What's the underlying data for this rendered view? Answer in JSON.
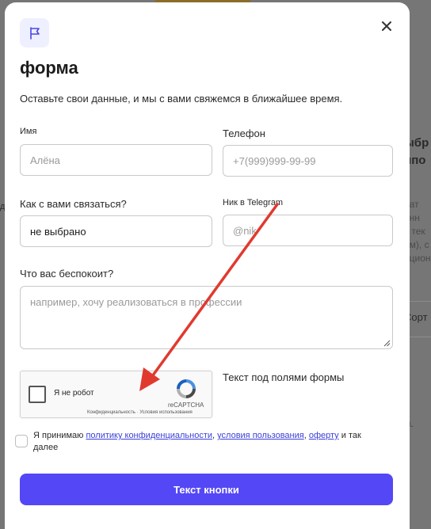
{
  "background": {
    "fragments": [
      "ыбр",
      "ипо",
      "рат",
      "анн",
      "с тек",
      "ом), с",
      "ацион",
      "Сорт",
      "м."
    ],
    "left_mark": "д"
  },
  "modal": {
    "logo_icon": "flag-icon",
    "close_icon": "close-icon",
    "title": "форма",
    "subtitle": "Оставьте свои данные, и мы с вами свяжемся в ближайшее время.",
    "fields": {
      "name": {
        "label": "Имя",
        "placeholder": "Алёна"
      },
      "phone": {
        "label": "Телефон",
        "placeholder": "+7(999)999-99-99"
      },
      "contact_method": {
        "label": "Как с вами связаться?",
        "value": "не выбрано"
      },
      "telegram": {
        "label": "Ник в Telegram",
        "placeholder": "@nik"
      },
      "concern": {
        "label": "Что вас беспокоит?",
        "placeholder": "например, хочу реализоваться в профессии"
      }
    },
    "recaptcha": {
      "label": "Я не робот",
      "brand": "reCAPTCHA",
      "terms": "Конфиденциальность · Условия использования"
    },
    "hint": "Текст под полями формы",
    "consent": {
      "prefix": "Я принимаю ",
      "link_privacy": "политику конфиденциальности",
      "sep1": ", ",
      "link_terms": "условия пользования",
      "sep2": ", ",
      "link_offer": "оферту",
      "suffix": " и так далее"
    },
    "submit_label": "Текст кнопки"
  },
  "colors": {
    "accent": "#5447f5",
    "annotation_arrow": "#e03a2f",
    "link": "#3a3fd8"
  }
}
